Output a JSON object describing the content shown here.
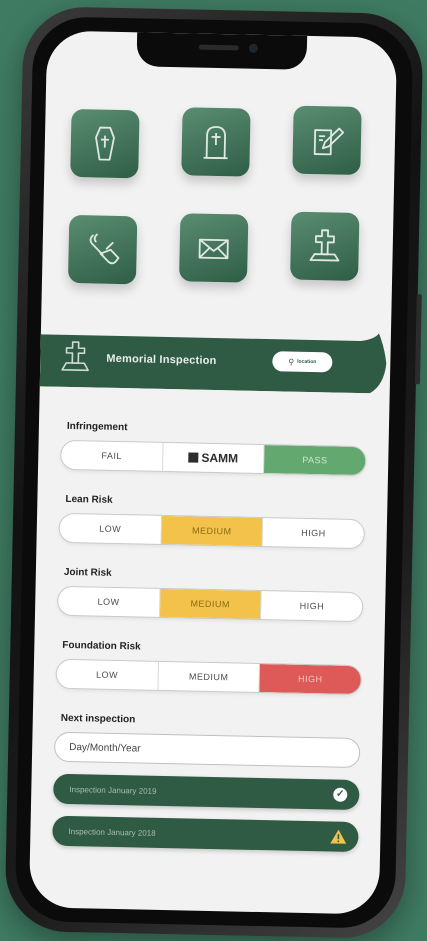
{
  "header": {
    "title": "Memorial Inspection",
    "pill_label": "location"
  },
  "icons": [
    "coffin-icon",
    "headstone-cross-icon",
    "edit-document-icon",
    "wrench-hand-icon",
    "envelope-icon",
    "grave-cross-icon"
  ],
  "form": {
    "infringement": {
      "label": "Infringement",
      "options": [
        "FAIL",
        "SAMM",
        "PASS"
      ],
      "selected": "PASS"
    },
    "lean_risk": {
      "label": "Lean Risk",
      "options": [
        "LOW",
        "MEDIUM",
        "HIGH"
      ],
      "selected": "MEDIUM"
    },
    "joint_risk": {
      "label": "Joint Risk",
      "options": [
        "LOW",
        "MEDIUM",
        "HIGH"
      ],
      "selected": "MEDIUM"
    },
    "foundation_risk": {
      "label": "Foundation Risk",
      "options": [
        "LOW",
        "MEDIUM",
        "HIGH"
      ],
      "selected": "HIGH"
    },
    "next_inspection": {
      "label": "Next inspection",
      "placeholder": "Day/Month/Year"
    }
  },
  "history": [
    {
      "label": "Inspection January 2019",
      "status": "passed"
    },
    {
      "label": "Inspection January 2018",
      "status": "warning"
    }
  ],
  "colors": {
    "brand_green": "#2f5a44",
    "pass": "#62a86f",
    "medium": "#f2c24a",
    "high": "#dd5a58"
  }
}
